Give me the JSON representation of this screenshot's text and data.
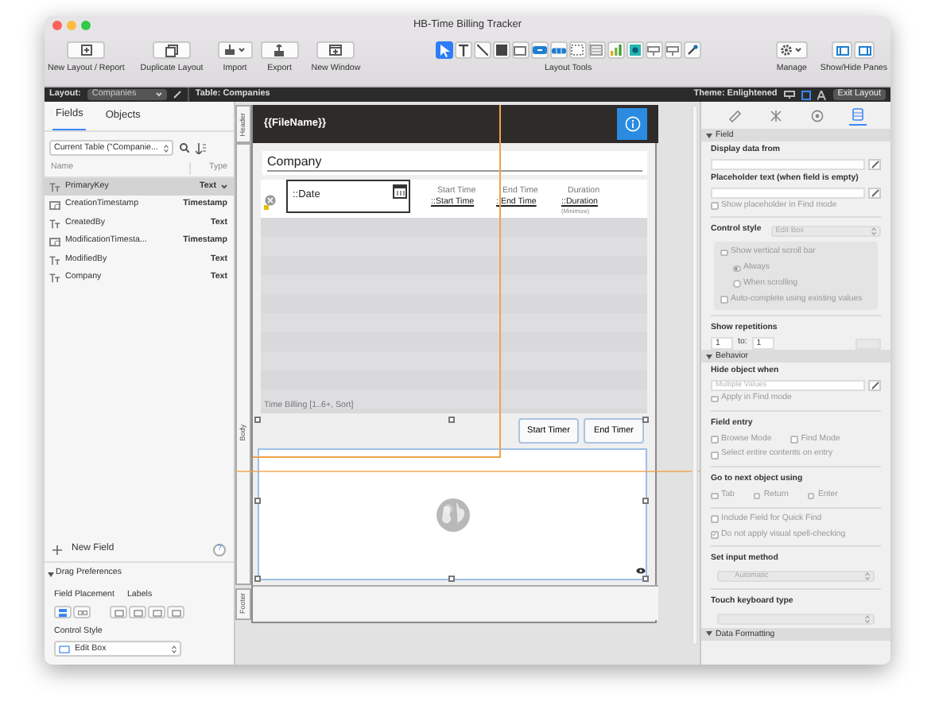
{
  "window": {
    "title": "HB-Time Billing Tracker"
  },
  "toolbar": {
    "left_buttons": [
      {
        "label": "New Layout / Report",
        "kind": "plus"
      },
      {
        "label": "Duplicate Layout",
        "kind": "duplicate"
      },
      {
        "label": "Import",
        "kind": "import"
      },
      {
        "label": "Export",
        "kind": "export"
      },
      {
        "label": "New Window",
        "kind": "window"
      }
    ],
    "tools_label": "Layout Tools",
    "tools": [
      {
        "kind": "pointer",
        "selected": true
      },
      {
        "kind": "text",
        "selected": false
      },
      {
        "kind": "line",
        "selected": false
      },
      {
        "kind": "rectangle",
        "selected": false
      },
      {
        "kind": "field",
        "selected": false
      },
      {
        "kind": "button",
        "selected": false
      },
      {
        "kind": "button-bar",
        "selected": false
      },
      {
        "kind": "popover",
        "selected": false
      },
      {
        "kind": "portal",
        "selected": false
      },
      {
        "kind": "chart",
        "selected": false
      },
      {
        "kind": "web-viewer",
        "selected": false
      },
      {
        "kind": "insert-field",
        "selected": false
      },
      {
        "kind": "insert-picture",
        "selected": false
      },
      {
        "kind": "eyedropper",
        "selected": false
      }
    ],
    "manage_label": "Manage",
    "panes_label": "Show/Hide Panes"
  },
  "layout_bar": {
    "layout_label": "Layout:",
    "layout": "Companies",
    "table": "Table: Companies",
    "theme": "Theme: Enlightened",
    "exit": "Exit Layout"
  },
  "left_panel": {
    "tabs": [
      {
        "label": "Fields",
        "selected": true
      },
      {
        "label": "Objects",
        "selected": false
      }
    ],
    "table_select": "Current Table (\"Companie...",
    "columns": [
      "Name",
      "Type"
    ],
    "fields": [
      {
        "name": "PrimaryKey",
        "type": "Text",
        "kind": "text",
        "selected": true
      },
      {
        "name": "CreationTimestamp",
        "type": "Timestamp",
        "kind": "timestamp",
        "selected": false
      },
      {
        "name": "CreatedBy",
        "type": "Text",
        "kind": "text",
        "selected": false
      },
      {
        "name": "ModificationTimesta...",
        "type": "Timestamp",
        "kind": "timestamp",
        "selected": false
      },
      {
        "name": "ModifiedBy",
        "type": "Text",
        "kind": "text",
        "selected": false
      },
      {
        "name": "Company",
        "type": "Text",
        "kind": "text",
        "selected": false
      }
    ],
    "new_field": "New Field",
    "help": "?",
    "drag_prefs": {
      "title": "Drag Preferences",
      "expanded": true,
      "placement_label": "Field Placement",
      "labels_label": "Labels",
      "control_style_label": "Control Style",
      "control_style": "Edit Box"
    }
  },
  "canvas": {
    "parts": [
      "Header",
      "Body",
      "Footer"
    ],
    "header_field": "{{FileName}}",
    "company_field": "Company",
    "date_field": "::Date",
    "columns": [
      {
        "label": "Start Time",
        "field": "::Start Time"
      },
      {
        "label": "End Time",
        "field": "::End Time"
      },
      {
        "label": "Duration",
        "field": "::Duration"
      }
    ],
    "note": "(Minimize)",
    "portal_label": "Time Billing [1..6+, Sort]",
    "buttons": [
      "Start Timer",
      "End Timer"
    ]
  },
  "inspector": {
    "tabs": [
      {
        "kind": "position",
        "selected": false
      },
      {
        "kind": "styles",
        "selected": false
      },
      {
        "kind": "appearance",
        "selected": false
      },
      {
        "kind": "data",
        "selected": true
      }
    ],
    "rows": [
      {
        "kind": "section",
        "text": "Field",
        "expanded": true
      },
      {
        "kind": "label",
        "text": "Display data from"
      },
      {
        "kind": "input"
      },
      {
        "kind": "label",
        "text": "Placeholder text (when field is empty)"
      },
      {
        "kind": "input"
      },
      {
        "kind": "checkbox",
        "text": "Show placeholder in Find mode",
        "checked": false
      },
      {
        "kind": "divider"
      },
      {
        "kind": "select",
        "label": "Control style",
        "value": "Edit Box"
      },
      {
        "kind": "group",
        "items": [
          {
            "kind": "checkbox",
            "text": "Show vertical scroll bar",
            "checked": false
          },
          {
            "kind": "radio",
            "text": "Always",
            "selected": true
          },
          {
            "kind": "radio",
            "text": "When scrolling",
            "selected": false
          },
          {
            "kind": "checkbox",
            "text": "Auto-complete using existing values",
            "checked": false
          }
        ]
      },
      {
        "kind": "divider"
      },
      {
        "kind": "label",
        "text": "Show repetitions"
      },
      {
        "kind": "repetitions",
        "from": "1",
        "to_label": "to:",
        "to": "1"
      },
      {
        "kind": "section",
        "text": "Behavior",
        "expanded": true
      },
      {
        "kind": "label",
        "text": "Hide object when"
      },
      {
        "kind": "input",
        "placeholder": "Multiple Values"
      },
      {
        "kind": "checkbox",
        "text": "Apply in Find mode",
        "checked": false
      },
      {
        "kind": "divider"
      },
      {
        "kind": "label",
        "text": "Field entry"
      },
      {
        "kind": "checkrow",
        "items": [
          {
            "text": "Browse Mode",
            "checked": false
          },
          {
            "text": "Find Mode",
            "checked": false
          }
        ]
      },
      {
        "kind": "checkbox",
        "text": "Select entire contents on entry",
        "checked": false
      },
      {
        "kind": "divider"
      },
      {
        "kind": "label",
        "text": "Go to next object using"
      },
      {
        "kind": "checkrow",
        "items": [
          {
            "text": "Tab",
            "checked": false
          },
          {
            "text": "Return",
            "checked": false
          },
          {
            "text": "Enter",
            "checked": false
          }
        ]
      },
      {
        "kind": "divider"
      },
      {
        "kind": "checkbox",
        "text": "Include Field for Quick Find",
        "checked": false
      },
      {
        "kind": "checkbox",
        "text": "Do not apply visual spell-checking",
        "checked": true
      },
      {
        "kind": "divider"
      },
      {
        "kind": "label",
        "text": "Set input method"
      },
      {
        "kind": "select",
        "value": "Automatic"
      },
      {
        "kind": "divider"
      },
      {
        "kind": "label",
        "text": "Touch keyboard type"
      },
      {
        "kind": "select"
      },
      {
        "kind": "section",
        "text": "Data Formatting",
        "expanded": true
      }
    ]
  }
}
